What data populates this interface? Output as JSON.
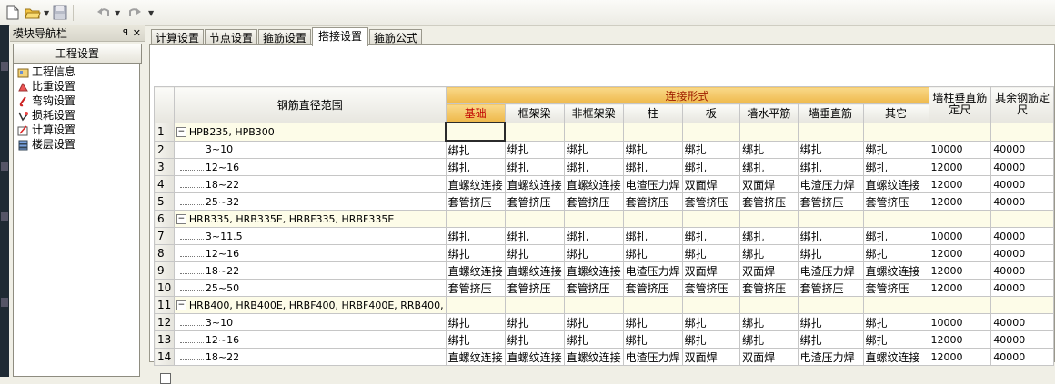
{
  "toolbar": {
    "icons": [
      "new-file-icon",
      "open-folder-icon",
      "save-icon",
      "undo-icon",
      "redo-icon"
    ]
  },
  "nav": {
    "title": "模块导航栏",
    "pin_symbol": "ꟼ",
    "close_symbol": "✕",
    "section": "工程设置",
    "items": [
      {
        "label": "工程信息",
        "icon": "project-info-icon"
      },
      {
        "label": "比重设置",
        "icon": "weight-icon"
      },
      {
        "label": "弯钩设置",
        "icon": "hook-icon"
      },
      {
        "label": "损耗设置",
        "icon": "loss-icon"
      },
      {
        "label": "计算设置",
        "icon": "calc-icon"
      },
      {
        "label": "楼层设置",
        "icon": "floor-icon"
      }
    ]
  },
  "tabs": [
    "计算设置",
    "节点设置",
    "箍筋设置",
    "搭接设置",
    "箍筋公式"
  ],
  "active_tab": "搭接设置",
  "grid": {
    "header_range": "钢筋直径范围",
    "header_group": "连接形式",
    "sub_headers": [
      "基础",
      "框架梁",
      "非框架梁",
      "柱",
      "板",
      "墙水平筋",
      "墙垂直筋",
      "其它"
    ],
    "header_wall": "墙柱垂直筋定尺",
    "header_other": "其余钢筋定尺",
    "rows": [
      {
        "num": "1",
        "label": "HPB235, HPB300",
        "group": true,
        "cells": [
          "",
          "",
          "",
          "",
          "",
          "",
          "",
          "",
          "",
          ""
        ]
      },
      {
        "num": "2",
        "label": "3~10",
        "group": false,
        "cells": [
          "绑扎",
          "绑扎",
          "绑扎",
          "绑扎",
          "绑扎",
          "绑扎",
          "绑扎",
          "绑扎",
          "10000",
          "40000"
        ]
      },
      {
        "num": "3",
        "label": "12~16",
        "group": false,
        "cells": [
          "绑扎",
          "绑扎",
          "绑扎",
          "绑扎",
          "绑扎",
          "绑扎",
          "绑扎",
          "绑扎",
          "12000",
          "40000"
        ]
      },
      {
        "num": "4",
        "label": "18~22",
        "group": false,
        "cells": [
          "直螺纹连接",
          "直螺纹连接",
          "直螺纹连接",
          "电渣压力焊",
          "双面焊",
          "双面焊",
          "电渣压力焊",
          "直螺纹连接",
          "12000",
          "40000"
        ]
      },
      {
        "num": "5",
        "label": "25~32",
        "group": false,
        "cells": [
          "套管挤压",
          "套管挤压",
          "套管挤压",
          "套管挤压",
          "套管挤压",
          "套管挤压",
          "套管挤压",
          "套管挤压",
          "12000",
          "40000"
        ]
      },
      {
        "num": "6",
        "label": "HRB335, HRB335E, HRBF335, HRBF335E",
        "group": true,
        "cells": [
          "",
          "",
          "",
          "",
          "",
          "",
          "",
          "",
          "",
          ""
        ]
      },
      {
        "num": "7",
        "label": "3~11.5",
        "group": false,
        "cells": [
          "绑扎",
          "绑扎",
          "绑扎",
          "绑扎",
          "绑扎",
          "绑扎",
          "绑扎",
          "绑扎",
          "10000",
          "40000"
        ]
      },
      {
        "num": "8",
        "label": "12~16",
        "group": false,
        "cells": [
          "绑扎",
          "绑扎",
          "绑扎",
          "绑扎",
          "绑扎",
          "绑扎",
          "绑扎",
          "绑扎",
          "12000",
          "40000"
        ]
      },
      {
        "num": "9",
        "label": "18~22",
        "group": false,
        "cells": [
          "直螺纹连接",
          "直螺纹连接",
          "直螺纹连接",
          "电渣压力焊",
          "双面焊",
          "双面焊",
          "电渣压力焊",
          "直螺纹连接",
          "12000",
          "40000"
        ]
      },
      {
        "num": "10",
        "label": "25~50",
        "group": false,
        "cells": [
          "套管挤压",
          "套管挤压",
          "套管挤压",
          "套管挤压",
          "套管挤压",
          "套管挤压",
          "套管挤压",
          "套管挤压",
          "12000",
          "40000"
        ]
      },
      {
        "num": "11",
        "label": "HRB400, HRB400E, HRBF400, HRBF400E, RRB400,",
        "group": true,
        "cells": [
          "",
          "",
          "",
          "",
          "",
          "",
          "",
          "",
          "",
          ""
        ]
      },
      {
        "num": "12",
        "label": "3~10",
        "group": false,
        "cells": [
          "绑扎",
          "绑扎",
          "绑扎",
          "绑扎",
          "绑扎",
          "绑扎",
          "绑扎",
          "绑扎",
          "10000",
          "40000"
        ]
      },
      {
        "num": "13",
        "label": "12~16",
        "group": false,
        "cells": [
          "绑扎",
          "绑扎",
          "绑扎",
          "绑扎",
          "绑扎",
          "绑扎",
          "绑扎",
          "绑扎",
          "12000",
          "40000"
        ]
      },
      {
        "num": "14",
        "label": "18~22",
        "group": false,
        "cells": [
          "直螺纹连接",
          "直螺纹连接",
          "直螺纹连接",
          "电渣压力焊",
          "双面焊",
          "双面焊",
          "电渣压力焊",
          "直螺纹连接",
          "12000",
          "40000"
        ]
      }
    ]
  }
}
